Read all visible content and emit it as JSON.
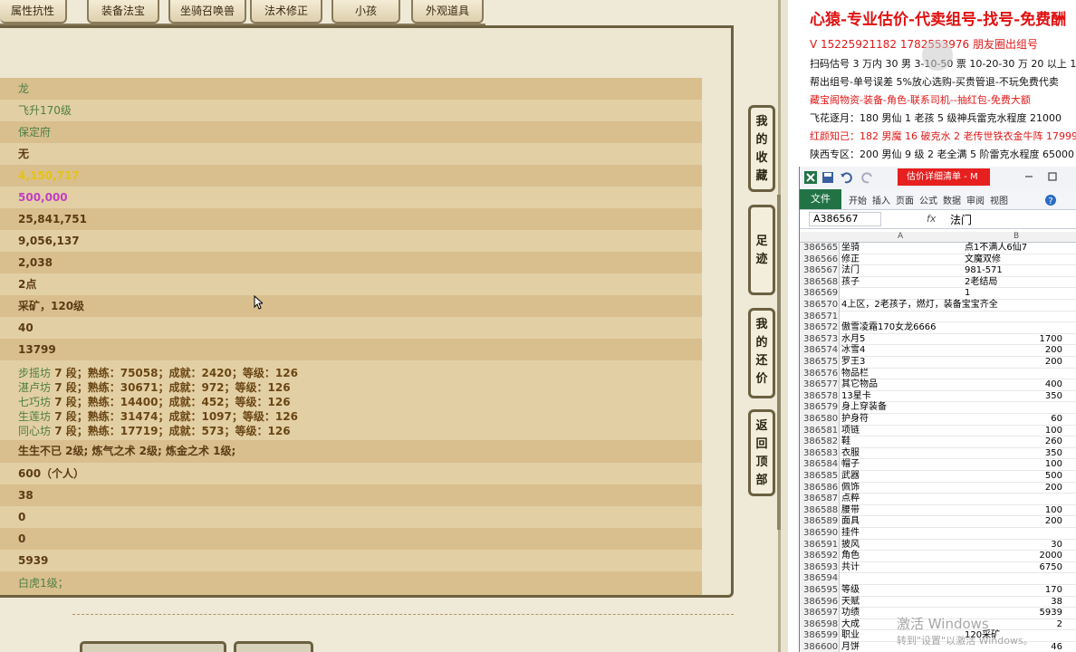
{
  "tabs": [
    "属性抗性",
    "装备法宝",
    "坐骑召唤兽",
    "法术修正",
    "小孩",
    "外观道具"
  ],
  "rows": [
    {
      "text": "龙",
      "style": "green"
    },
    {
      "text": "飞升170级",
      "style": "green"
    },
    {
      "text": "保定府",
      "style": "green"
    },
    {
      "text": "无",
      "style": "brown"
    },
    {
      "text": "4,150,717",
      "style": "yellow"
    },
    {
      "text": "500,000",
      "style": "magenta"
    },
    {
      "text": "25,841,751",
      "style": "brown"
    },
    {
      "text": "9,056,137",
      "style": "brown"
    },
    {
      "text": "2,038",
      "style": "brown"
    },
    {
      "text": "2点",
      "style": "brown"
    },
    {
      "text": "采矿，120级",
      "style": "brown"
    },
    {
      "text": "40",
      "style": "brown"
    },
    {
      "text": "13799",
      "style": "brown"
    }
  ],
  "skills": [
    {
      "name": "步摇坊",
      "detail": " 7 段；熟练：75058；成就：2420；等级：126"
    },
    {
      "name": "湛卢坊",
      "detail": " 7 段；熟练：30671；成就：972；等级：126"
    },
    {
      "name": "七巧坊",
      "detail": " 7 段；熟练：14400；成就：452；等级：126"
    },
    {
      "name": "生莲坊",
      "detail": " 7 段；熟练：31474；成就：1097；等级：126"
    },
    {
      "name": "同心坊",
      "detail": " 7 段；熟练：17719；成就：573；等级：126"
    }
  ],
  "rows2": [
    {
      "text": "生生不已 2级; 炼气之术 2级; 炼金之术 1级;",
      "style": "brown"
    },
    {
      "text": "600（个人）",
      "style": "brown"
    },
    {
      "text": "38",
      "style": "brown"
    },
    {
      "text": "0",
      "style": "brown"
    },
    {
      "text": "0",
      "style": "brown"
    },
    {
      "text": "5939",
      "style": "brown"
    },
    {
      "text": "白虎1级；",
      "style": "green"
    }
  ],
  "side_buttons": [
    "我的收藏",
    "足迹",
    "我的还价",
    "返回顶部"
  ],
  "doc": {
    "title": "心猿-专业估价-代卖组号-找号-免费酬",
    "lines": [
      {
        "text": "V 15225921182   1782553976 朋友圈出组号",
        "color": "red"
      },
      {
        "text": "扫码估号 3 万内 30 男 3-10-50 票 10-20-30 万 20 以上 1",
        "color": "black"
      },
      {
        "text": "帮出组号-单号误差 5%放心选购-买贵管退-不玩免费代卖",
        "color": "black"
      },
      {
        "text": "藏宝阁物资-装备-角色-联系司机--抽红包-免费大额",
        "color": "red"
      },
      {
        "text": "飞花逐月：180 男仙 1 老孩 5 级神兵雷克水程度 21000",
        "color": "black"
      },
      {
        "text": "红颜知己：182 男魔 16 破克水 2 老传世铁衣金牛阵 17999",
        "color": "red"
      },
      {
        "text": "陕西专区：200 男仙 9 级 2 老全满 5 阶雷克水程度 65000",
        "color": "black"
      }
    ]
  },
  "excel": {
    "title_tag": "估价详细清单 - M",
    "file_tab": "文件",
    "ribbon_tabs": [
      "开始",
      "插入",
      "页面",
      "公式",
      "数据",
      "审阅",
      "视图"
    ],
    "name_box": "A386567",
    "fx": "fx",
    "formula": "法门",
    "columns": [
      "A",
      "B"
    ],
    "rows": [
      {
        "n": "386565",
        "a": "坐骑",
        "b": "点1不满人6仙7",
        "num": ""
      },
      {
        "n": "386566",
        "a": "修正",
        "b": "文魔双修",
        "num": ""
      },
      {
        "n": "386567",
        "a": "法门",
        "b": "981-571",
        "num": ""
      },
      {
        "n": "386568",
        "a": "孩子",
        "b": "2老结局",
        "num": ""
      },
      {
        "n": "386569",
        "a": "",
        "b": "1",
        "num": ""
      },
      {
        "n": "386570",
        "a": "4上区，2老孩子，燃灯，装备宝宝齐全",
        "b": "",
        "num": ""
      },
      {
        "n": "386571",
        "a": "",
        "b": "",
        "num": ""
      },
      {
        "n": "386572",
        "a": "傲雪凌霜170女龙6666",
        "b": "",
        "num": ""
      },
      {
        "n": "386573",
        "a": "水月5",
        "b": "",
        "num": "1700"
      },
      {
        "n": "386574",
        "a": "冰雪4",
        "b": "",
        "num": "200"
      },
      {
        "n": "386575",
        "a": "罗王3",
        "b": "",
        "num": "200"
      },
      {
        "n": "386576",
        "a": "物品栏",
        "b": "",
        "num": ""
      },
      {
        "n": "386577",
        "a": "其它物品",
        "b": "",
        "num": "400"
      },
      {
        "n": "386578",
        "a": "13星卡",
        "b": "",
        "num": "350"
      },
      {
        "n": "386579",
        "a": "身上穿装备",
        "b": "",
        "num": ""
      },
      {
        "n": "386580",
        "a": "护身符",
        "b": "",
        "num": "60"
      },
      {
        "n": "386581",
        "a": "项链",
        "b": "",
        "num": "100"
      },
      {
        "n": "386582",
        "a": "鞋",
        "b": "",
        "num": "260"
      },
      {
        "n": "386583",
        "a": "衣服",
        "b": "",
        "num": "350"
      },
      {
        "n": "386584",
        "a": "帽子",
        "b": "",
        "num": "100"
      },
      {
        "n": "386585",
        "a": "武器",
        "b": "",
        "num": "500"
      },
      {
        "n": "386586",
        "a": "佩饰",
        "b": "",
        "num": "200"
      },
      {
        "n": "386587",
        "a": "点粹",
        "b": "",
        "num": ""
      },
      {
        "n": "386588",
        "a": "腰带",
        "b": "",
        "num": "100"
      },
      {
        "n": "386589",
        "a": "面具",
        "b": "",
        "num": "200"
      },
      {
        "n": "386590",
        "a": "挂件",
        "b": "",
        "num": ""
      },
      {
        "n": "386591",
        "a": "披风",
        "b": "",
        "num": "30"
      },
      {
        "n": "386592",
        "a": "角色",
        "b": "",
        "num": "2000"
      },
      {
        "n": "386593",
        "a": "共计",
        "b": "",
        "num": "6750"
      },
      {
        "n": "386594",
        "a": "",
        "b": "",
        "num": ""
      },
      {
        "n": "386595",
        "a": "等级",
        "b": "",
        "num": "170"
      },
      {
        "n": "386596",
        "a": "天赋",
        "b": "",
        "num": "38"
      },
      {
        "n": "386597",
        "a": "功绩",
        "b": "",
        "num": "5939"
      },
      {
        "n": "386598",
        "a": "大成",
        "b": "",
        "num": "2"
      },
      {
        "n": "386599",
        "a": "职业",
        "b": "120采矿",
        "num": ""
      },
      {
        "n": "386600",
        "a": "月饼",
        "b": "",
        "num": "46"
      }
    ]
  },
  "watermark": {
    "line1": "激活 Windows",
    "line2": "转到\"设置\"以激活 Windows。"
  }
}
